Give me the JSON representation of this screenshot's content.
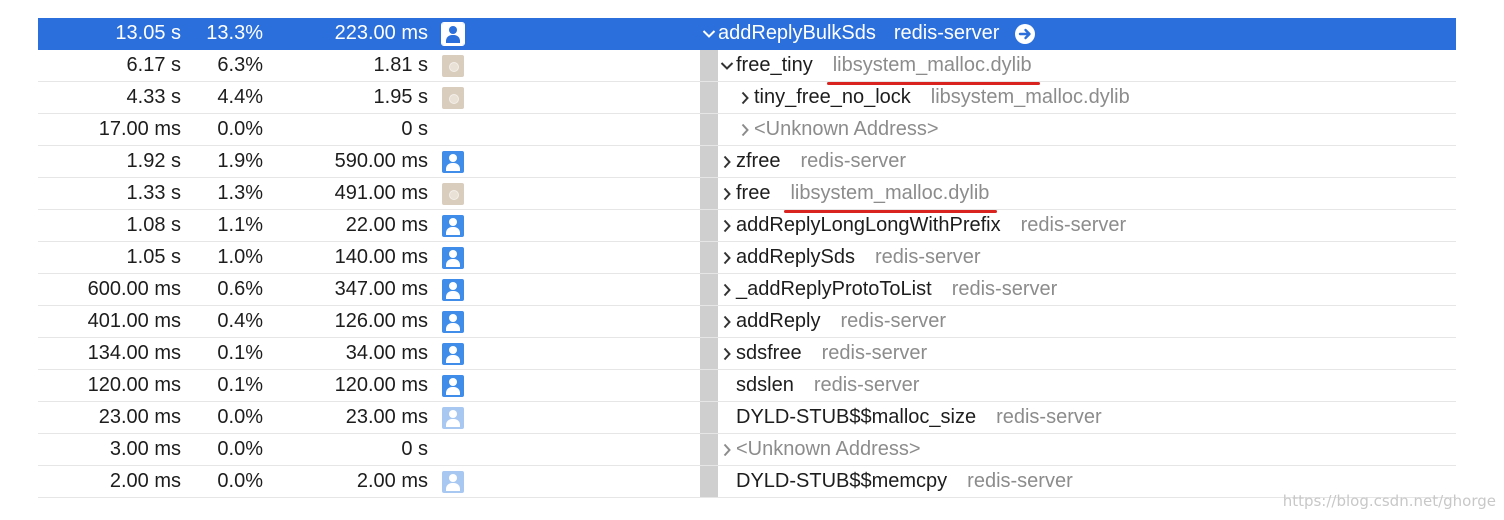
{
  "rows": [
    {
      "weight": "13.05 s",
      "pct": "13.3%",
      "self": "223.00 ms",
      "icon": "user-icon",
      "symbol": "addReplyBulkSds",
      "library": "redis-server",
      "disclosure": "expanded",
      "indent": 0,
      "selected": true
    },
    {
      "weight": "6.17 s",
      "pct": "6.3%",
      "self": "1.81 s",
      "icon": "gear-icon",
      "symbol": "free_tiny",
      "library": "libsystem_malloc.dylib",
      "disclosure": "expanded",
      "indent": 1,
      "underline": true
    },
    {
      "weight": "4.33 s",
      "pct": "4.4%",
      "self": "1.95 s",
      "icon": "gear-icon",
      "symbol": "tiny_free_no_lock",
      "library": "libsystem_malloc.dylib",
      "disclosure": "collapsed",
      "indent": 2
    },
    {
      "weight": "17.00 ms",
      "pct": "0.0%",
      "self": "0 s",
      "icon": "",
      "symbol": "<Unknown Address>",
      "library": "",
      "disclosure": "collapsed",
      "indent": 2,
      "unknown": true
    },
    {
      "weight": "1.92 s",
      "pct": "1.9%",
      "self": "590.00 ms",
      "icon": "user-icon",
      "symbol": "zfree",
      "library": "redis-server",
      "disclosure": "collapsed",
      "indent": 1
    },
    {
      "weight": "1.33 s",
      "pct": "1.3%",
      "self": "491.00 ms",
      "icon": "gear-icon",
      "symbol": "free",
      "library": "libsystem_malloc.dylib",
      "disclosure": "collapsed",
      "indent": 1,
      "underline": true
    },
    {
      "weight": "1.08 s",
      "pct": "1.1%",
      "self": "22.00 ms",
      "icon": "user-icon",
      "symbol": "addReplyLongLongWithPrefix",
      "library": "redis-server",
      "disclosure": "collapsed",
      "indent": 1
    },
    {
      "weight": "1.05 s",
      "pct": "1.0%",
      "self": "140.00 ms",
      "icon": "user-icon",
      "symbol": "addReplySds",
      "library": "redis-server",
      "disclosure": "collapsed",
      "indent": 1
    },
    {
      "weight": "600.00 ms",
      "pct": "0.6%",
      "self": "347.00 ms",
      "icon": "user-icon",
      "symbol": "_addReplyProtoToList",
      "library": "redis-server",
      "disclosure": "collapsed",
      "indent": 1
    },
    {
      "weight": "401.00 ms",
      "pct": "0.4%",
      "self": "126.00 ms",
      "icon": "user-icon",
      "symbol": "addReply",
      "library": "redis-server",
      "disclosure": "collapsed",
      "indent": 1
    },
    {
      "weight": "134.00 ms",
      "pct": "0.1%",
      "self": "34.00 ms",
      "icon": "user-icon",
      "symbol": "sdsfree",
      "library": "redis-server",
      "disclosure": "collapsed",
      "indent": 1
    },
    {
      "weight": "120.00 ms",
      "pct": "0.1%",
      "self": "120.00 ms",
      "icon": "user-icon",
      "symbol": "sdslen",
      "library": "redis-server",
      "disclosure": "none",
      "indent": 1
    },
    {
      "weight": "23.00 ms",
      "pct": "0.0%",
      "self": "23.00 ms",
      "icon": "user-icon-light",
      "symbol": "DYLD-STUB$$malloc_size",
      "library": "redis-server",
      "disclosure": "none",
      "indent": 1
    },
    {
      "weight": "3.00 ms",
      "pct": "0.0%",
      "self": "0 s",
      "icon": "",
      "symbol": "<Unknown Address>",
      "library": "",
      "disclosure": "collapsed",
      "indent": 1,
      "unknown": true
    },
    {
      "weight": "2.00 ms",
      "pct": "0.0%",
      "self": "2.00 ms",
      "icon": "user-icon-light",
      "symbol": "DYLD-STUB$$memcpy",
      "library": "redis-server",
      "disclosure": "none",
      "indent": 1
    }
  ],
  "watermark": "https://blog.csdn.net/ghorge",
  "colors": {
    "selection": "#2a6fdb",
    "user_icon": "#3f8de8",
    "system_icon": "#d9cdbd",
    "library_text": "#8c8c8c",
    "annotation_underline": "#d9231f"
  }
}
